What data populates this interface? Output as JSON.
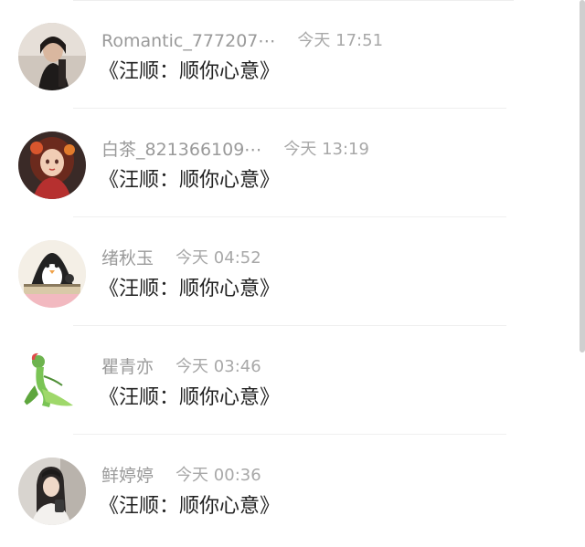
{
  "comments": [
    {
      "username": "Romantic_777207⋯",
      "time": "今天 17:51",
      "message": "《汪顺：顺你心意》",
      "avatar_icon": "user-avatar-dark-portrait"
    },
    {
      "username": "白茶_821366109⋯",
      "time": "今天 13:19",
      "message": "《汪顺：顺你心意》",
      "avatar_icon": "user-avatar-anime-girl"
    },
    {
      "username": "绪秋玉",
      "time": "今天 04:52",
      "message": "《汪顺：顺你心意》",
      "avatar_icon": "user-avatar-penguin"
    },
    {
      "username": "瞿青亦",
      "time": "今天 03:46",
      "message": "《汪顺：顺你心意》",
      "avatar_icon": "user-avatar-green-creature"
    },
    {
      "username": "鲜婷婷",
      "time": "今天 00:36",
      "message": "《汪顺：顺你心意》",
      "avatar_icon": "user-avatar-girl-photo"
    }
  ],
  "colors": {
    "username": "#9a9a9a",
    "time": "#a8a8a8",
    "message": "#222222",
    "divider": "#efefef",
    "scrollbar": "#cfcfcf"
  }
}
